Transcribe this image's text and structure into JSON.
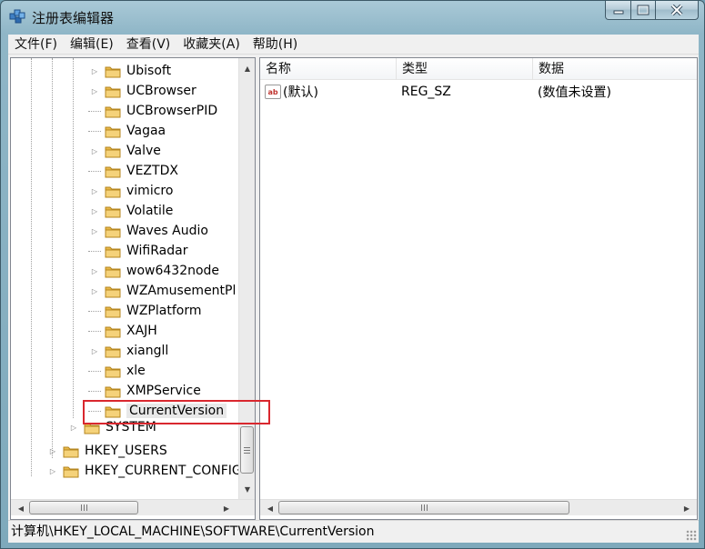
{
  "window": {
    "title": "注册表编辑器"
  },
  "menu": [
    "文件(F)",
    "编辑(E)",
    "查看(V)",
    "收藏夹(A)",
    "帮助(H)"
  ],
  "tree": {
    "items": [
      {
        "label": "Ubisoft",
        "expandable": true
      },
      {
        "label": "UCBrowser",
        "expandable": true
      },
      {
        "label": "UCBrowserPID",
        "expandable": false
      },
      {
        "label": "Vagaa",
        "expandable": false
      },
      {
        "label": "Valve",
        "expandable": true
      },
      {
        "label": "VEZTDX",
        "expandable": false
      },
      {
        "label": "vimicro",
        "expandable": true
      },
      {
        "label": "Volatile",
        "expandable": true
      },
      {
        "label": "Waves Audio",
        "expandable": true
      },
      {
        "label": "WifiRadar",
        "expandable": false
      },
      {
        "label": "wow6432node",
        "expandable": true
      },
      {
        "label": "WZAmusementPl",
        "expandable": true
      },
      {
        "label": "WZPlatform",
        "expandable": false
      },
      {
        "label": "XAJH",
        "expandable": false
      },
      {
        "label": "xiangll",
        "expandable": true
      },
      {
        "label": "xle",
        "expandable": false
      },
      {
        "label": "XMPService",
        "expandable": false
      },
      {
        "label": "CurrentVersion",
        "expandable": false,
        "selected": true
      }
    ],
    "system": "SYSTEM",
    "roots": [
      "HKEY_USERS",
      "HKEY_CURRENT_CONFIG"
    ]
  },
  "list": {
    "columns": [
      "名称",
      "类型",
      "数据"
    ],
    "rows": [
      {
        "name": "(默认)",
        "type": "REG_SZ",
        "data": "(数值未设置)"
      }
    ]
  },
  "status": {
    "path": "计算机\\HKEY_LOCAL_MACHINE\\SOFTWARE\\CurrentVersion"
  },
  "colors": {
    "highlight_box": "#d9272e",
    "folder": "#e8b84a"
  }
}
